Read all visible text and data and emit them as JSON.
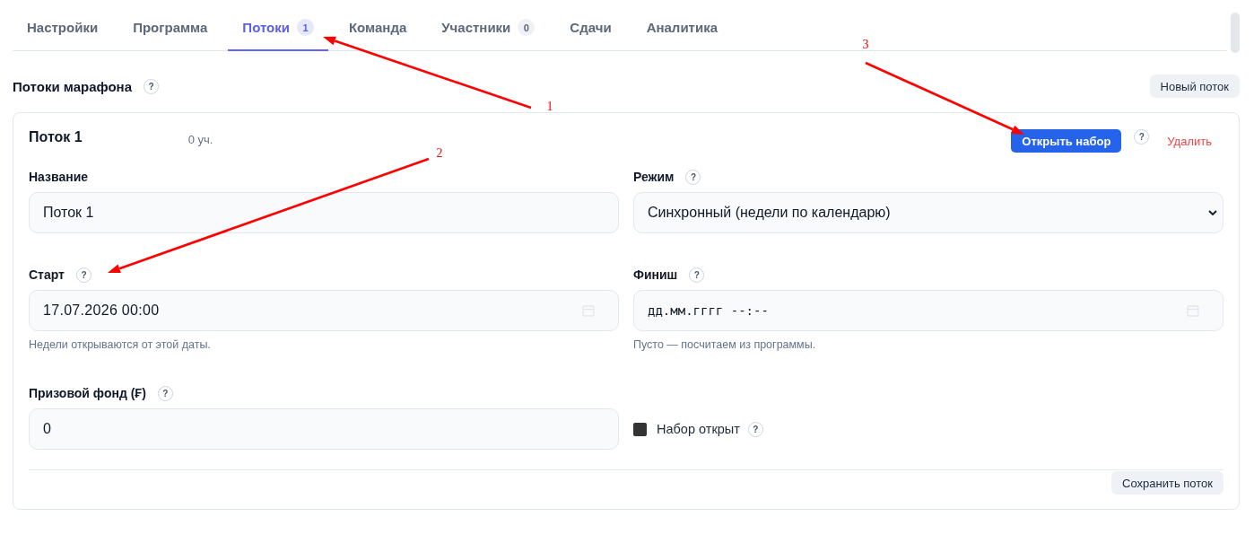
{
  "tabs": [
    {
      "label": "Настройки",
      "selected": false
    },
    {
      "label": "Программа",
      "selected": false
    },
    {
      "label": "Потоки",
      "badge": "1",
      "selected": true
    },
    {
      "label": "Команда",
      "selected": false
    },
    {
      "label": "Участники",
      "badge": "0",
      "selected": false
    },
    {
      "label": "Сдачи",
      "selected": false
    },
    {
      "label": "Аналитика",
      "selected": false
    }
  ],
  "section": {
    "title": "Потоки марафона",
    "help": "?",
    "new_button": "Новый поток"
  },
  "stream": {
    "title": "Поток 1",
    "participants": "0 уч.",
    "open_button": "Открыть набор",
    "open_help": "?",
    "delete_button": "Удалить",
    "fields": [
      {
        "kind": "text",
        "label": "Название",
        "value": "Поток 1"
      },
      {
        "kind": "select",
        "label": "Режим",
        "help": "?",
        "value": "Синхронный (недели по календарю)"
      },
      {
        "kind": "date",
        "label": "Старт",
        "help": "?",
        "value": "17.07.2026 00:00",
        "hint": "Недели открываются от этой даты."
      },
      {
        "kind": "date",
        "label": "Финиш",
        "help": "?",
        "placeholder": "дд.мм.гггг --:--",
        "hint": "Пусто — посчитаем из программы."
      },
      {
        "kind": "text",
        "label": "Призовой фонд (₣)",
        "help": "?",
        "value": "0"
      },
      {
        "kind": "checkbox",
        "label": "Набор открыт",
        "help": "?",
        "checked": false
      }
    ],
    "save_button": "Сохранить поток"
  },
  "annotations": [
    {
      "label": "1"
    },
    {
      "label": "2"
    },
    {
      "label": "3"
    }
  ]
}
